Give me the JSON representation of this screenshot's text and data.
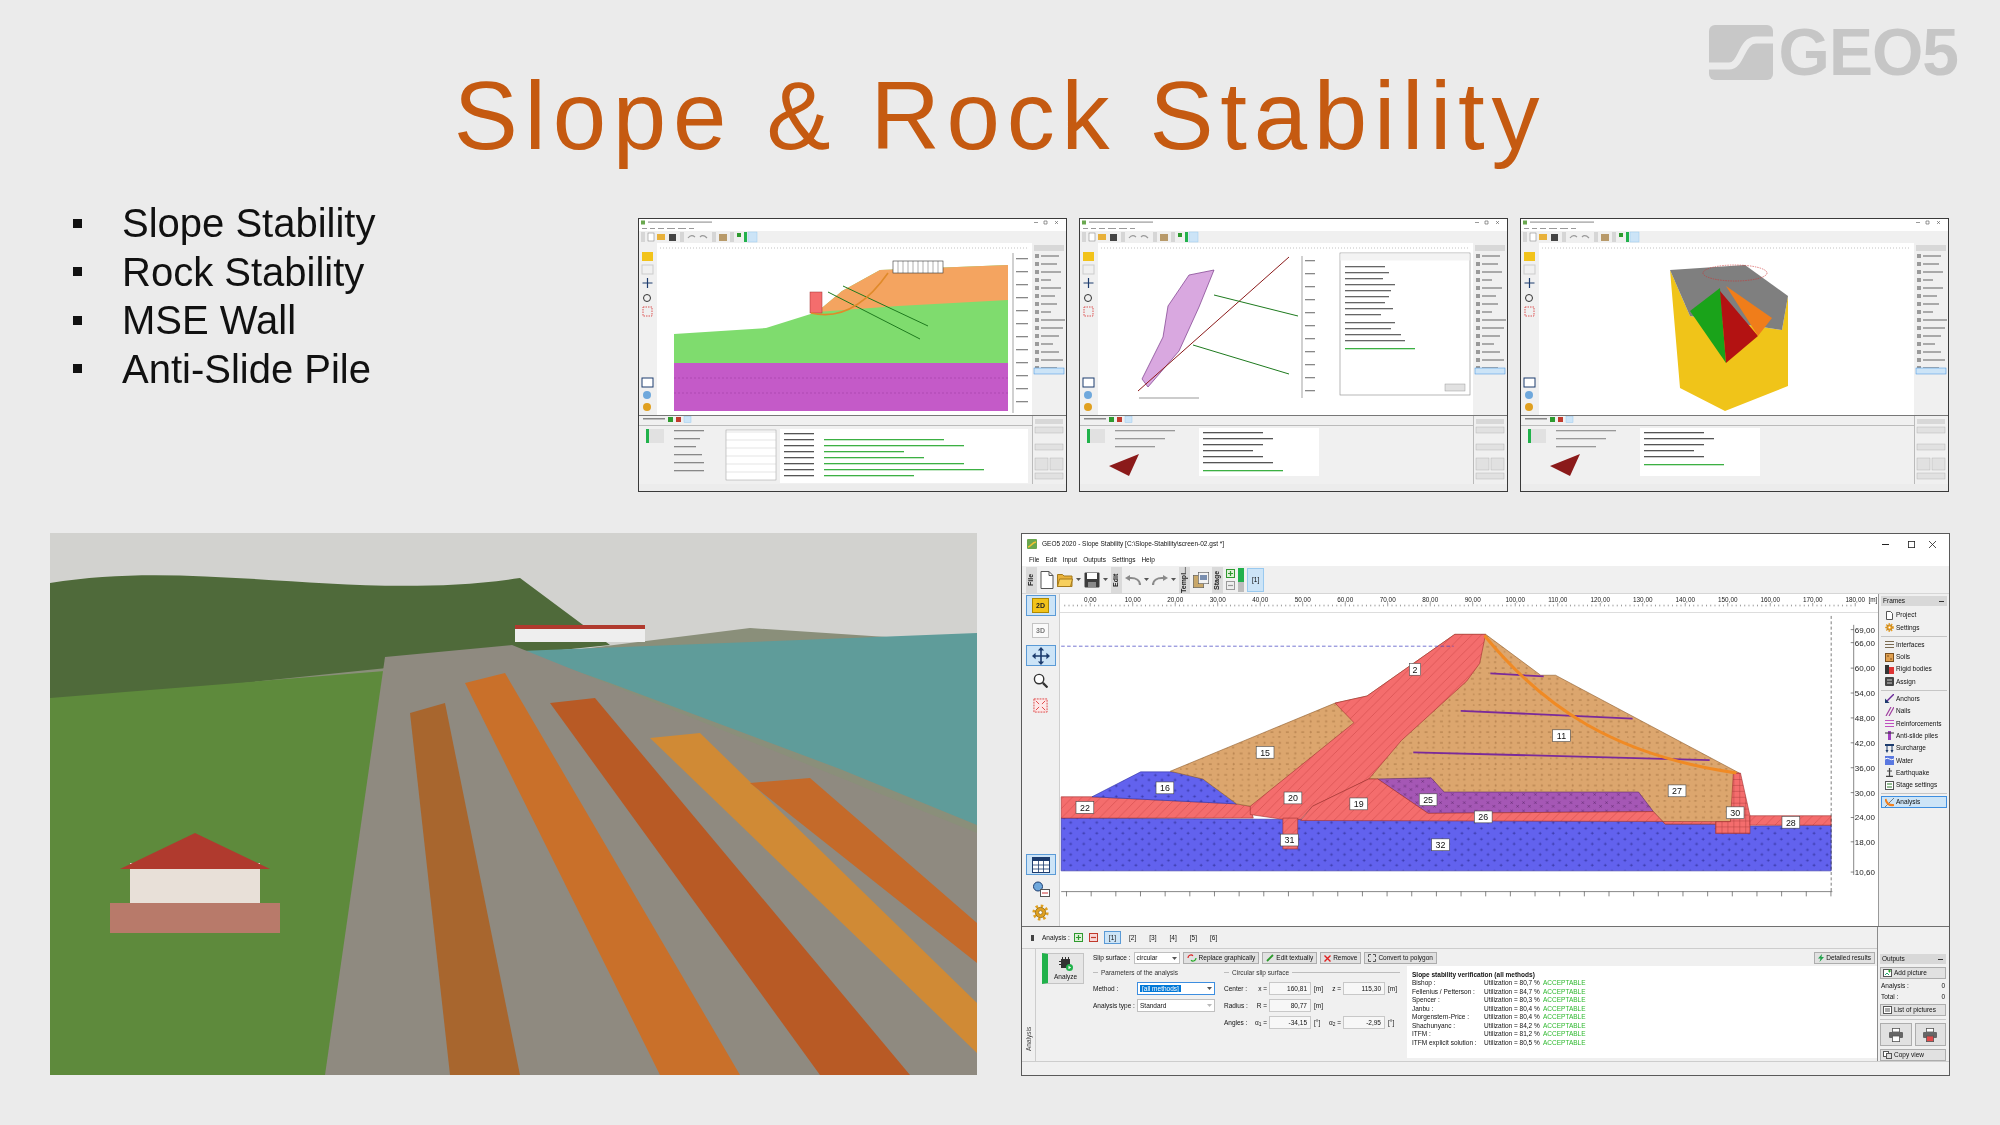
{
  "slide": {
    "title": "Slope & Rock Stability",
    "logo": "GEO5",
    "bullets": [
      "Slope Stability",
      "Rock Stability",
      "MSE Wall",
      "Anti-Slide Pile"
    ]
  },
  "thumbnails": [
    {
      "kind": "slope"
    },
    {
      "kind": "plane"
    },
    {
      "kind": "wedge"
    }
  ],
  "app": {
    "title": "GEO5 2020 - Slope Stability [C:\\Slope-Stability\\screen-02.gst *]",
    "menu": [
      "File",
      "Edit",
      "Input",
      "Outputs",
      "Settings",
      "Help"
    ],
    "toolbar_groups": [
      "File",
      "Edit",
      "Templ...",
      "Stage"
    ],
    "stage_button": {
      "label": "[1]",
      "selected": true
    },
    "tools": [
      {
        "kind": "plan",
        "label": "2D",
        "selected": true,
        "disabled": false
      },
      {
        "kind": "spatial",
        "label": "3D",
        "selected": false,
        "disabled": true
      },
      {
        "kind": "pan",
        "selected": true,
        "disabled": false
      },
      {
        "kind": "zoom",
        "selected": false,
        "disabled": false
      },
      {
        "kind": "fit",
        "selected": false,
        "disabled": false
      },
      {
        "kind": "table",
        "selected": true,
        "disabled": false
      },
      {
        "kind": "legend",
        "selected": false,
        "disabled": false
      },
      {
        "kind": "settings",
        "selected": false,
        "disabled": false
      }
    ],
    "ruler": {
      "labels": [
        "0,00",
        "10,00",
        "20,00",
        "30,00",
        "40,00",
        "50,00",
        "60,00",
        "70,00",
        "80,00",
        "90,00",
        "100,00",
        "110,00",
        "120,00",
        "130,00",
        "140,00",
        "150,00",
        "160,00",
        "170,00",
        "180,00"
      ],
      "unit": "[m]"
    },
    "axis_labels": [
      "69,00",
      "66,00",
      "60,00",
      "54,00",
      "48,00",
      "42,00",
      "36,00",
      "30,00",
      "24,00",
      "18,00",
      "10,60"
    ],
    "region_labels": [
      "2",
      "15",
      "16",
      "22",
      "20",
      "19",
      "31",
      "32",
      "25",
      "26",
      "11",
      "27",
      "30",
      "28"
    ],
    "frames": {
      "title": "Frames",
      "groups": [
        {
          "items": [
            {
              "label": "Project",
              "selected": false
            },
            {
              "label": "Settings",
              "selected": false
            }
          ]
        },
        {
          "items": [
            {
              "label": "Interfaces",
              "selected": false
            },
            {
              "label": "Soils",
              "selected": false
            },
            {
              "label": "Rigid bodies",
              "selected": false
            },
            {
              "label": "Assign",
              "selected": false
            }
          ]
        },
        {
          "items": [
            {
              "label": "Anchors",
              "selected": false
            },
            {
              "label": "Nails",
              "selected": false
            },
            {
              "label": "Reinforcements",
              "selected": false
            },
            {
              "label": "Anti-slide piles",
              "selected": false
            },
            {
              "label": "Surcharge",
              "selected": false
            },
            {
              "label": "Water",
              "selected": false
            },
            {
              "label": "Earthquake",
              "selected": false
            },
            {
              "label": "Stage settings",
              "selected": false
            }
          ]
        },
        {
          "items": [
            {
              "label": "Analysis",
              "selected": true
            }
          ]
        }
      ]
    },
    "analysis": {
      "label": "Analysis :",
      "stages": [
        {
          "label": "[1]",
          "selected": true
        },
        {
          "label": "[2]",
          "selected": false
        },
        {
          "label": "[3]",
          "selected": false
        },
        {
          "label": "[4]",
          "selected": false
        },
        {
          "label": "[5]",
          "selected": false
        },
        {
          "label": "[6]",
          "selected": false
        }
      ],
      "side_tab": "Analysis",
      "analyze": "Analyze",
      "slip_surface": {
        "label": "Slip surface :",
        "value": "circular"
      },
      "actions": [
        {
          "kind": "replace",
          "label": "Replace graphically"
        },
        {
          "kind": "edit",
          "label": "Edit textually"
        },
        {
          "kind": "remove",
          "label": "Remove"
        },
        {
          "kind": "convert",
          "label": "Convert to polygon"
        }
      ],
      "detailed_results": "Detailed results",
      "parameters": {
        "title": "Parameters of the analysis",
        "method": {
          "label": "Method :",
          "value": "[all methods]",
          "highlighted": true
        },
        "analysis_type": {
          "label": "Analysis type :",
          "value": "Standard",
          "disabled": true
        }
      },
      "circle": {
        "title": "Circular slip surface",
        "rows": [
          {
            "label": "Center :",
            "fields": [
              {
                "symbol": "x =",
                "value": "160,81",
                "unit": "[m]"
              },
              {
                "symbol": "z =",
                "value": "115,30",
                "unit": "[m]"
              }
            ]
          },
          {
            "label": "Radius :",
            "fields": [
              {
                "symbol": "R =",
                "value": "80,77",
                "unit": "[m]"
              }
            ]
          },
          {
            "label": "Angles :",
            "fields": [
              {
                "symbol": "α$_{1}$ =",
                "value": "-34,15",
                "unit": "[°]"
              },
              {
                "symbol": "α$_{2}$ =",
                "value": "-2,95",
                "unit": "[°]"
              }
            ]
          }
        ]
      },
      "results": {
        "title": "Slope stability verification (all methods)",
        "rows": [
          {
            "method": "Bishop :",
            "utilization": "Utilization = 80,7 %",
            "verdict": "ACCEPTABLE"
          },
          {
            "method": "Fellenius / Petterson :",
            "utilization": "Utilization = 84,7 %",
            "verdict": "ACCEPTABLE"
          },
          {
            "method": "Spencer :",
            "utilization": "Utilization = 80,3 %",
            "verdict": "ACCEPTABLE"
          },
          {
            "method": "Janbu :",
            "utilization": "Utilization = 80,4 %",
            "verdict": "ACCEPTABLE"
          },
          {
            "method": "Morgenstern-Price :",
            "utilization": "Utilization = 80,4 %",
            "verdict": "ACCEPTABLE"
          },
          {
            "method": "Shachunyanc :",
            "utilization": "Utilization = 84,2 %",
            "verdict": "ACCEPTABLE"
          },
          {
            "method": "ITFM :",
            "utilization": "Utilization = 81,2 %",
            "verdict": "ACCEPTABLE"
          },
          {
            "method": "ITFM explicit solution :",
            "utilization": "Utilization = 80,5 %",
            "verdict": "ACCEPTABLE"
          }
        ]
      }
    },
    "outputs": {
      "title": "Outputs",
      "add_picture": "Add picture",
      "counts": [
        {
          "label": "Analysis :",
          "value": "0"
        },
        {
          "label": "Total :",
          "value": "0"
        }
      ],
      "list_pictures": "List of pictures",
      "copy_view": "Copy view"
    }
  }
}
